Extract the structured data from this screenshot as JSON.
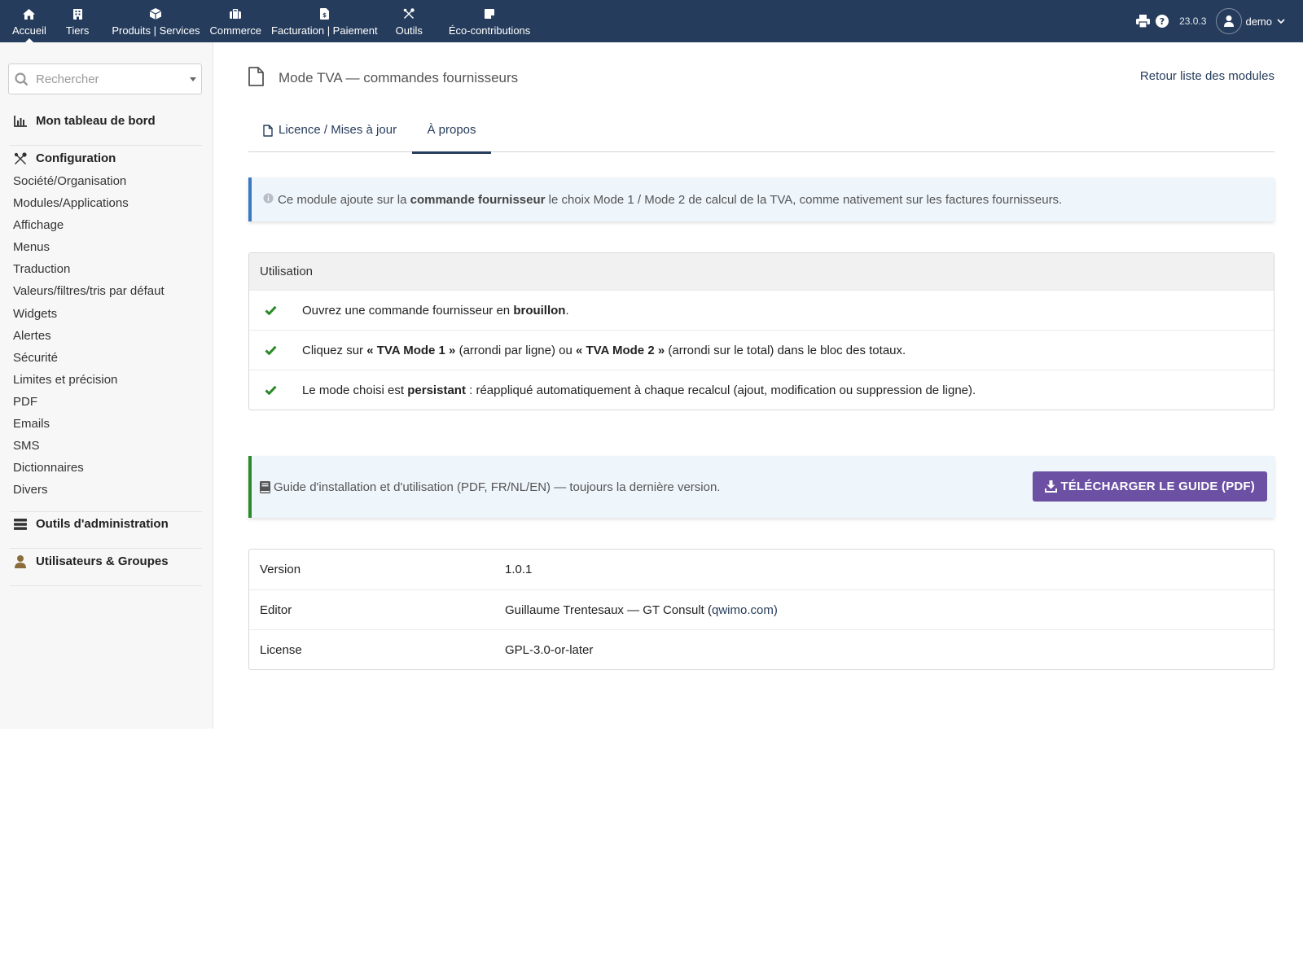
{
  "topnav": {
    "items": [
      {
        "label": "Accueil",
        "icon": "home-icon"
      },
      {
        "label": "Tiers",
        "icon": "building-icon"
      },
      {
        "label": "Produits | Services",
        "icon": "cube-icon"
      },
      {
        "label": "Commerce",
        "icon": "suitcase-icon"
      },
      {
        "label": "Facturation | Paiement",
        "icon": "invoice-icon"
      },
      {
        "label": "Outils",
        "icon": "tools-icon"
      },
      {
        "label": "Éco-contributions",
        "icon": "note-icon"
      }
    ],
    "active_index": 0,
    "version": "23.0.3",
    "username": "demo"
  },
  "sidebar": {
    "search_placeholder": "Rechercher",
    "dashboard": "Mon tableau de bord",
    "configuration": "Configuration",
    "config_items": [
      "Société/Organisation",
      "Modules/Applications",
      "Affichage",
      "Menus",
      "Traduction",
      "Valeurs/filtres/tris par défaut",
      "Widgets",
      "Alertes",
      "Sécurité",
      "Limites et précision",
      "PDF",
      "Emails",
      "SMS",
      "Dictionnaires",
      "Divers"
    ],
    "admin_tools": "Outils d'administration",
    "users_groups": "Utilisateurs & Groupes"
  },
  "page": {
    "title": "Mode TVA — commandes fournisseurs",
    "back_link": "Retour liste des modules",
    "tabs": [
      {
        "label": "Licence / Mises à jour",
        "active": false
      },
      {
        "label": "À propos",
        "active": true
      }
    ]
  },
  "info": {
    "prefix": "Ce module ajoute sur la",
    "bold": "commande fournisseur",
    "suffix": "le choix Mode 1 / Mode 2 de calcul de la TVA, comme nativement sur les factures fournisseurs."
  },
  "usage": {
    "heading": "Utilisation",
    "rows": [
      {
        "a": "Ouvrez une commande fournisseur en ",
        "b": "brouillon",
        "c": ".",
        "d": "",
        "e": ""
      },
      {
        "a": "Cliquez sur ",
        "b": "« TVA Mode 1 »",
        "c": " (arrondi par ligne) ou ",
        "d": "« TVA Mode 2 »",
        "e": " (arrondi sur le total) dans le bloc des totaux."
      },
      {
        "a": "Le mode choisi est ",
        "b": "persistant",
        "c": " : réappliqué automatiquement à chaque recalcul (ajout, modification ou suppression de ligne).",
        "d": "",
        "e": ""
      }
    ]
  },
  "guide": {
    "text": "Guide d'installation et d'utilisation (PDF, FR/NL/EN) — toujours la dernière version.",
    "button": "TÉLÉCHARGER LE GUIDE (PDF)"
  },
  "props": {
    "version_label": "Version",
    "version_value": "1.0.1",
    "editor_label": "Editor",
    "editor_value": "Guillaume Trentesaux — GT Consult (",
    "editor_link": "qwimo.com)",
    "license_label": "License",
    "license_value": "GPL-3.0-or-later"
  },
  "colors": {
    "topbar": "#263c5c",
    "accent": "#263c5c",
    "check": "#2b8a2b",
    "download_button": "#6b50a3",
    "info_border": "#3a78c2",
    "guide_border": "#2b8a2b"
  }
}
